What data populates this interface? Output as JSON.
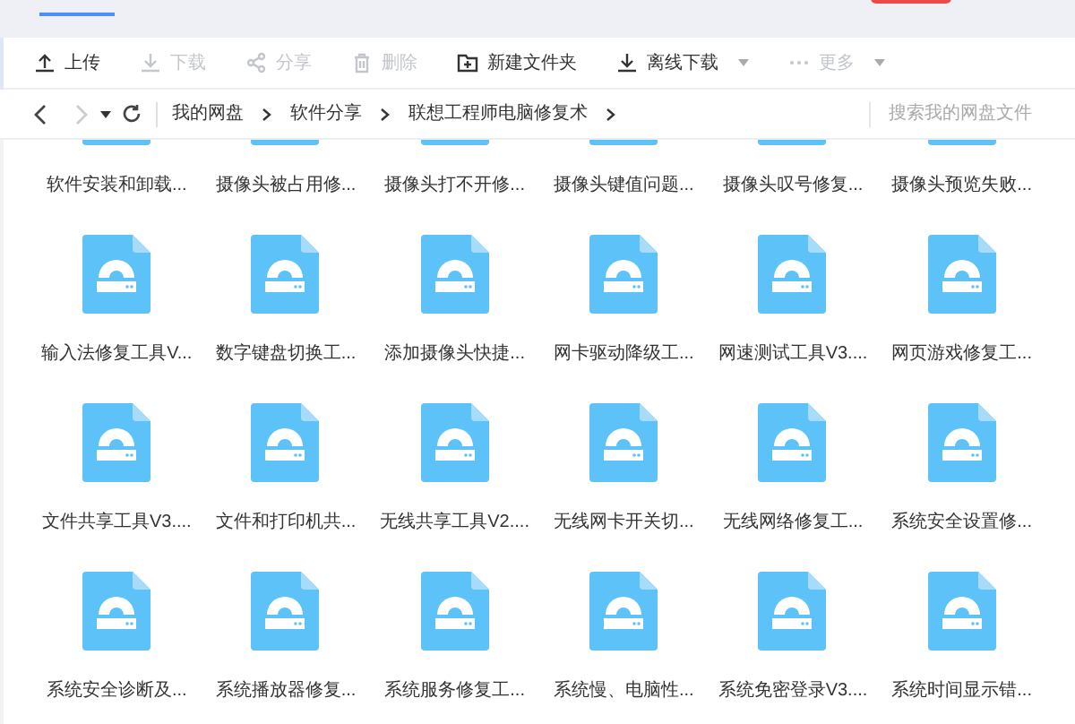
{
  "toolbar": [
    {
      "label": "上传",
      "kind": "upload",
      "disabled": false,
      "caret": false
    },
    {
      "label": "下载",
      "kind": "download",
      "disabled": true,
      "caret": false
    },
    {
      "label": "分享",
      "kind": "share",
      "disabled": true,
      "caret": false
    },
    {
      "label": "删除",
      "kind": "delete",
      "disabled": true,
      "caret": false
    },
    {
      "label": "新建文件夹",
      "kind": "folder",
      "disabled": false,
      "caret": false
    },
    {
      "label": "离线下载",
      "kind": "download",
      "disabled": false,
      "caret": true
    },
    {
      "label": "更多",
      "kind": "more",
      "disabled": true,
      "caret": true
    }
  ],
  "breadcrumb": [
    "我的网盘",
    "软件分享",
    "联想工程师电脑修复术"
  ],
  "search": {
    "placeholder": "搜索我的网盘文件"
  },
  "files": [
    {
      "name": "软件安装和卸载..."
    },
    {
      "name": "摄像头被占用修..."
    },
    {
      "name": "摄像头打不开修..."
    },
    {
      "name": "摄像头键值问题..."
    },
    {
      "name": "摄像头叹号修复..."
    },
    {
      "name": "摄像头预览失败..."
    },
    {
      "name": "输入法修复工具V..."
    },
    {
      "name": "数字键盘切换工..."
    },
    {
      "name": "添加摄像头快捷..."
    },
    {
      "name": "网卡驱动降级工..."
    },
    {
      "name": "网速测试工具V3...."
    },
    {
      "name": "网页游戏修复工..."
    },
    {
      "name": "文件共享工具V3...."
    },
    {
      "name": "文件和打印机共..."
    },
    {
      "name": "无线共享工具V2...."
    },
    {
      "name": "无线网卡开关切..."
    },
    {
      "name": "无线网络修复工..."
    },
    {
      "name": "系统安全设置修..."
    },
    {
      "name": "系统安全诊断及..."
    },
    {
      "name": "系统播放器修复..."
    },
    {
      "name": "系统服务修复工..."
    },
    {
      "name": "系统慢、电脑性..."
    },
    {
      "name": "系统免密登录V3...."
    },
    {
      "name": "系统时间显示错..."
    }
  ]
}
